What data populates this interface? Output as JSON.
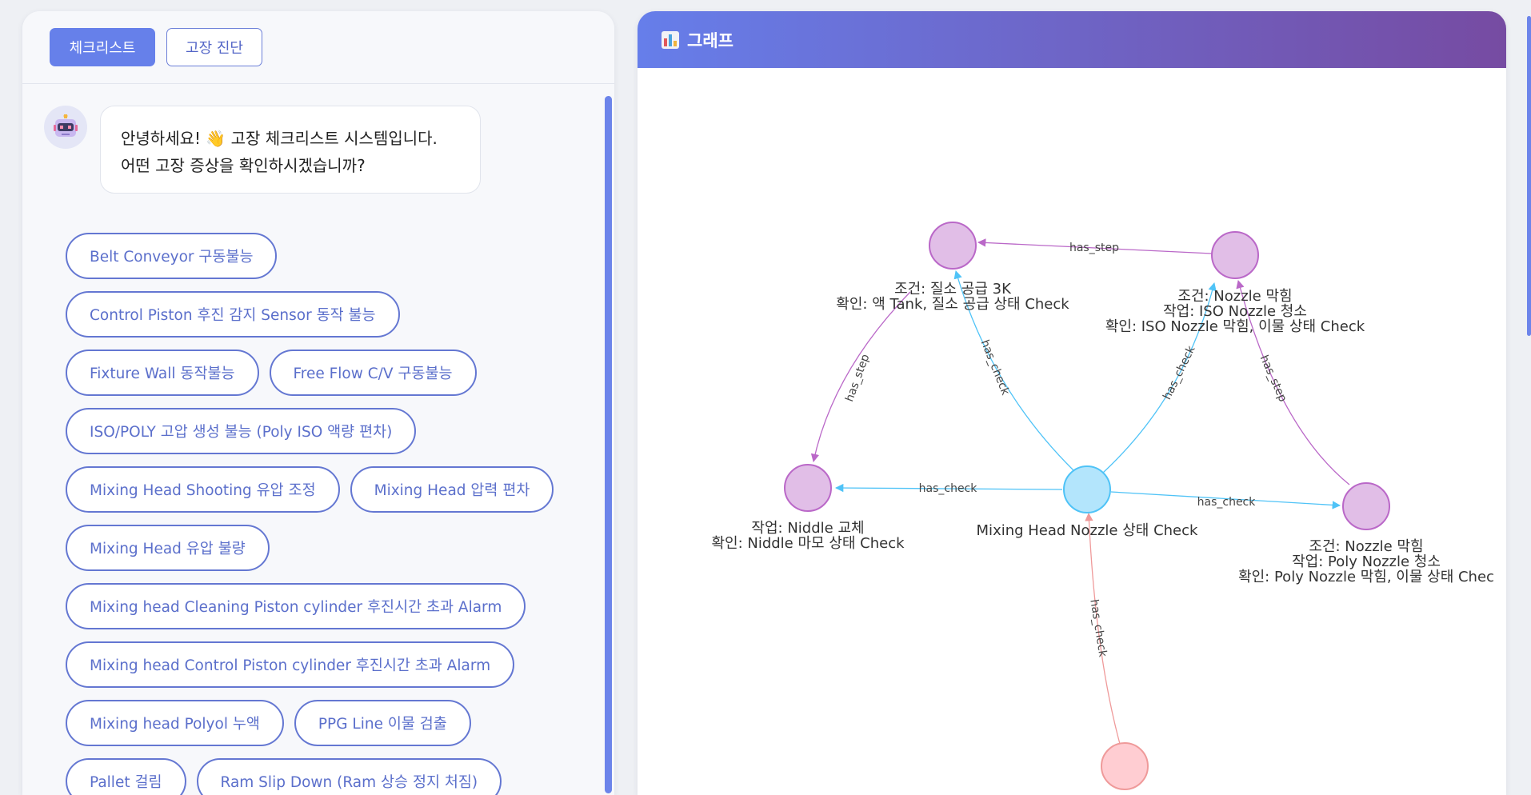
{
  "tabs": [
    {
      "label": "체크리스트"
    },
    {
      "label": "고장 진단"
    }
  ],
  "chat": {
    "bot_message_lines": [
      "안녕하세요! 👋 고장 체크리스트 시스템입니다.",
      "어떤 고장 증상을 확인하시겠습니까?"
    ]
  },
  "chips": [
    "Belt Conveyor 구동불능",
    "Control Piston 후진 감지 Sensor 동작 불능",
    "Fixture Wall 동작불능",
    "Free Flow C/V 구동불능",
    "ISO/POLY 고압 생성 불능 (Poly ISO 액량 편차)",
    "Mixing Head Shooting 유압 조정",
    "Mixing Head 압력 편차",
    "Mixing Head 유압 불량",
    "Mixing head Cleaning Piston cylinder 후진시간 초과 Alarm",
    "Mixing head Control Piston cylinder 후진시간 초과 Alarm",
    "Mixing head Polyol 누액",
    "PPG Line 이물 검출",
    "Pallet 걸림",
    "Ram Slip Down (Ram 상승 정지 처짐)"
  ],
  "graph": {
    "title": "그래프",
    "header_icon": "bar-chart-icon",
    "colors": {
      "header_start": "#667eea",
      "header_end": "#764ba2",
      "step_node": "#e1bee7",
      "step_border": "#ba68c8",
      "check_node": "#b3e5fc",
      "check_border": "#4fc3f7",
      "alarm_node": "#ffcdd2",
      "alarm_border": "#ef9a9a"
    },
    "nodes": [
      {
        "id": "n1",
        "kind": "step",
        "label_lines": [
          "조건: 질소 공급 3K",
          "확인: 액 Tank, 질소 공급 상태 Check"
        ]
      },
      {
        "id": "n2",
        "kind": "step",
        "label_lines": [
          "조건: Nozzle 막힘",
          "작업: ISO Nozzle 청소",
          "확인: ISO Nozzle 막힘, 이물 상태 Check"
        ]
      },
      {
        "id": "n3",
        "kind": "step",
        "label_lines": [
          "작업: Niddle 교체",
          "확인: Niddle 마모 상태 Check"
        ]
      },
      {
        "id": "n4",
        "kind": "check",
        "label_lines": [
          "Mixing Head Nozzle 상태 Check"
        ]
      },
      {
        "id": "n5",
        "kind": "step",
        "label_lines": [
          "조건: Nozzle 막힘",
          "작업: Poly Nozzle 청소",
          "확인: Poly Nozzle 막힘, 이물 상태 Chec"
        ]
      },
      {
        "id": "n6",
        "kind": "alarm",
        "label_lines": []
      }
    ],
    "edges": [
      {
        "id": "e1",
        "label": "has_step"
      },
      {
        "id": "e2",
        "label": "has_step"
      },
      {
        "id": "e3",
        "label": "has_check"
      },
      {
        "id": "e4",
        "label": "has_check"
      },
      {
        "id": "e5",
        "label": "has_step"
      },
      {
        "id": "e6",
        "label": "has_check"
      },
      {
        "id": "e7",
        "label": "has_check"
      },
      {
        "id": "e8",
        "label": "has_check"
      }
    ]
  }
}
